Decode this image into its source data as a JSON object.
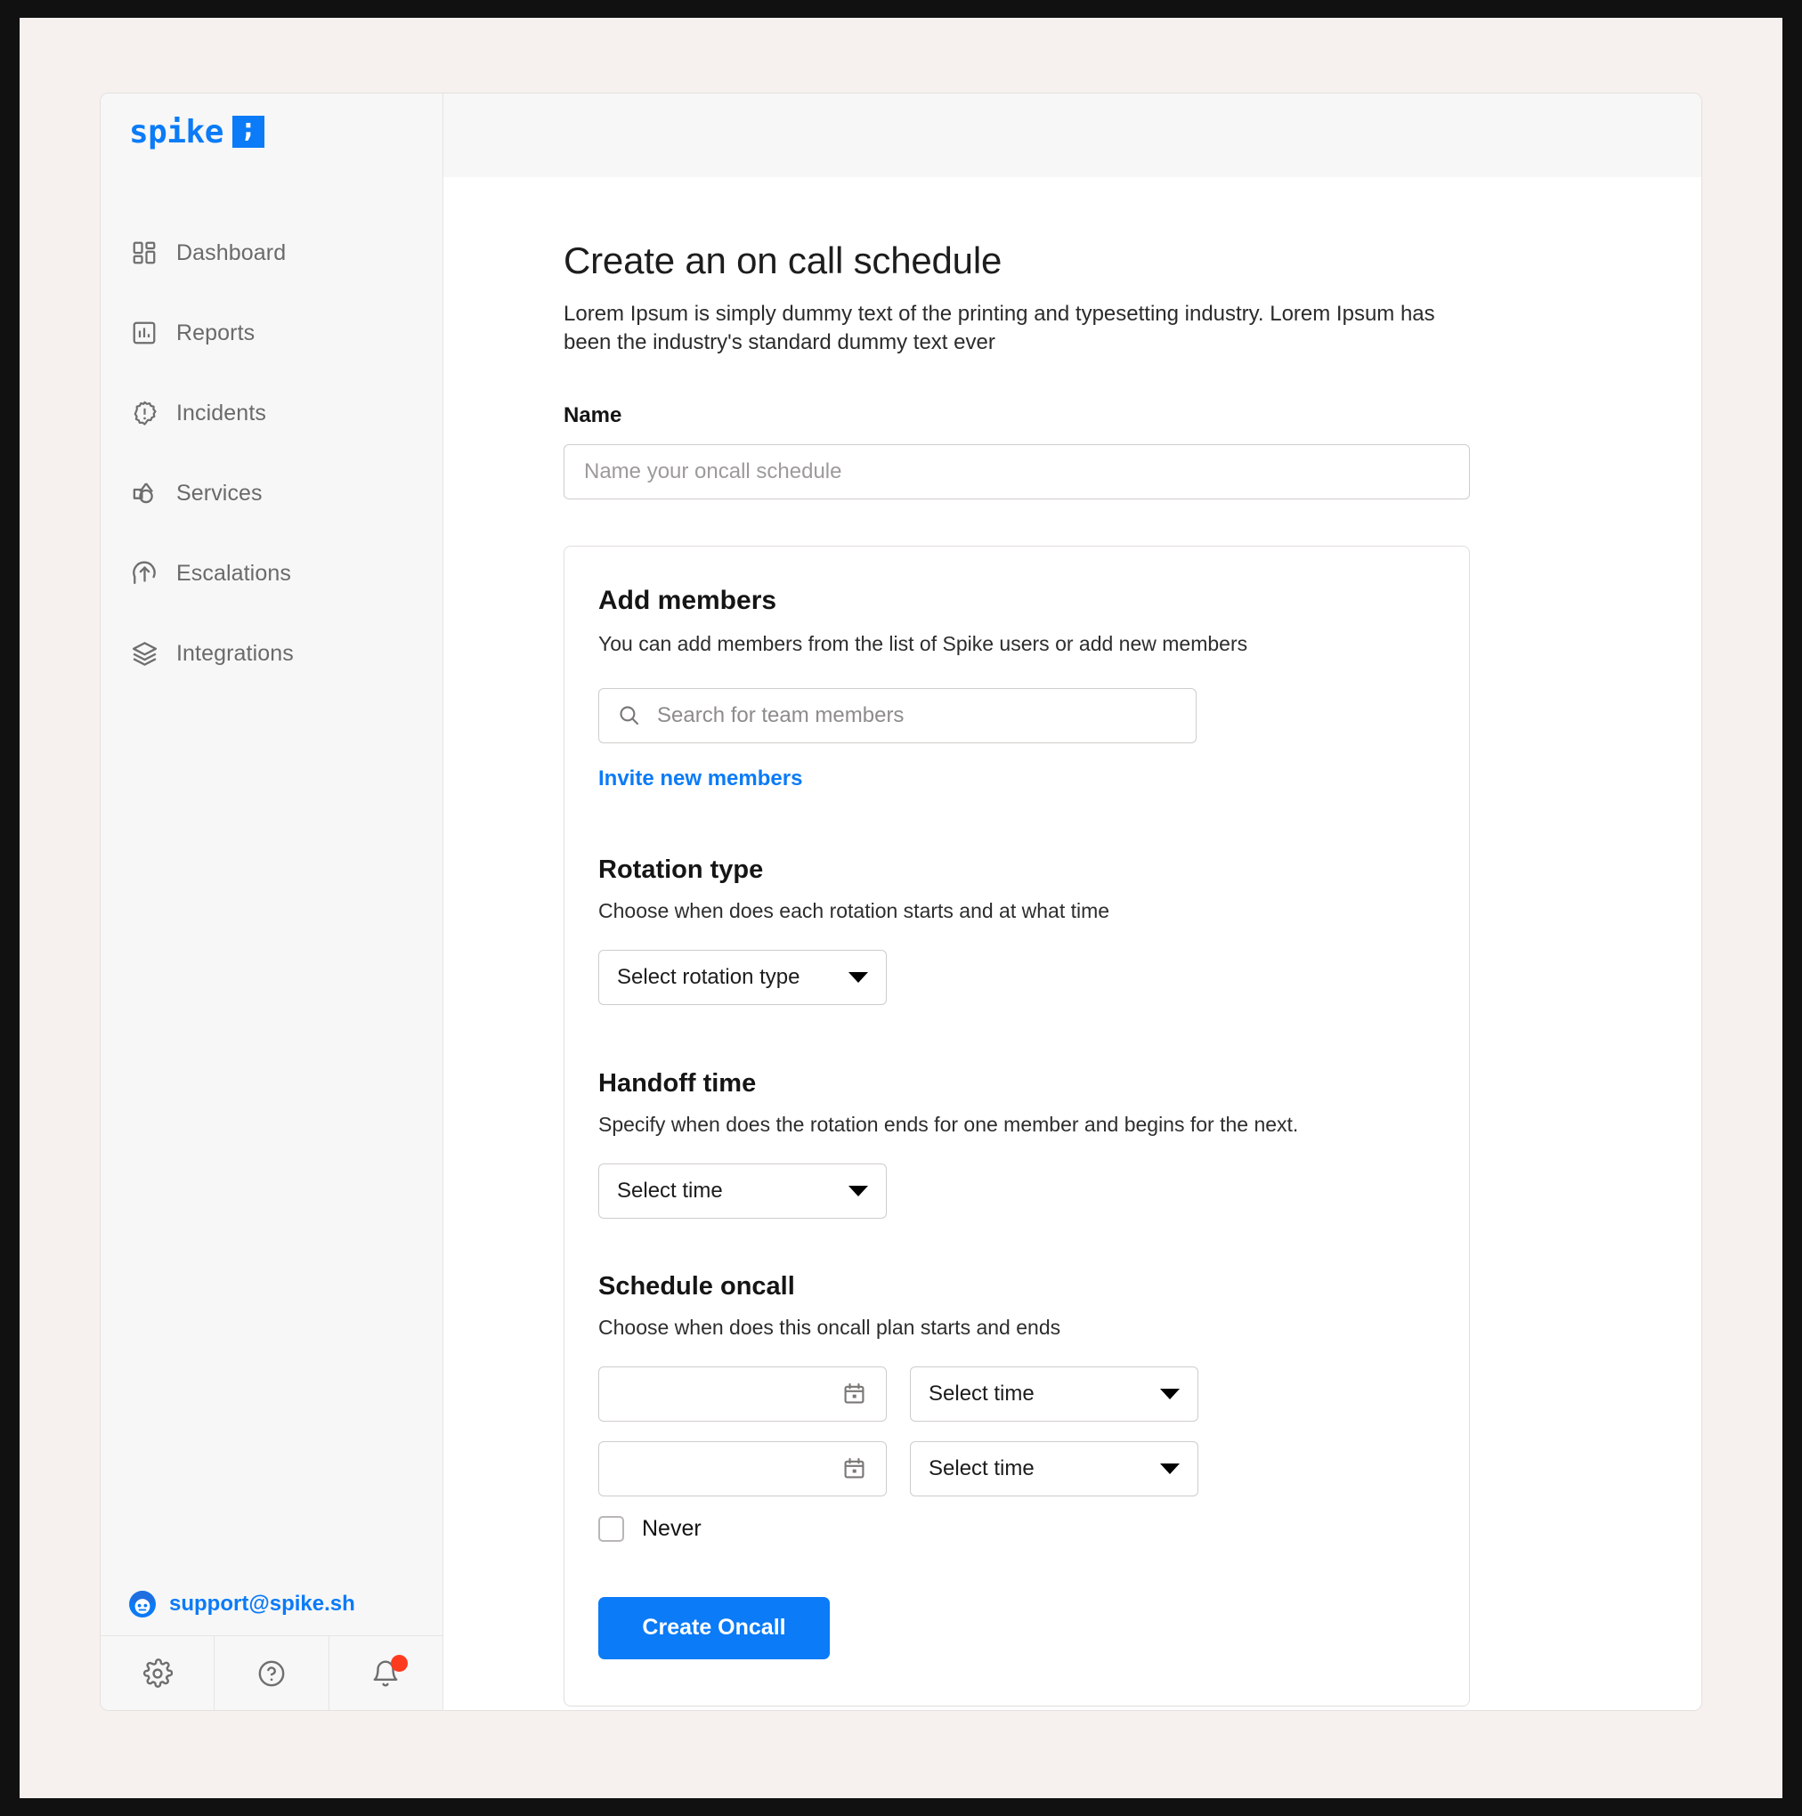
{
  "brand": {
    "word": "spike",
    "mark_glyph": ";",
    "accent_color": "#0b7bf7"
  },
  "sidebar": {
    "items": [
      {
        "label": "Dashboard",
        "icon": "dashboard-icon"
      },
      {
        "label": "Reports",
        "icon": "reports-icon"
      },
      {
        "label": "Incidents",
        "icon": "incidents-icon"
      },
      {
        "label": "Services",
        "icon": "services-icon"
      },
      {
        "label": "Escalations",
        "icon": "escalations-icon"
      },
      {
        "label": "Integrations",
        "icon": "integrations-icon"
      }
    ],
    "support_email": "support@spike.sh",
    "footer": {
      "settings_icon": "gear-icon",
      "help_icon": "question-circle-icon",
      "notifications_icon": "bell-icon",
      "notification_dot_color": "#ff3b1f"
    }
  },
  "main": {
    "title": "Create an on call schedule",
    "subtitle": "Lorem Ipsum is simply dummy text of the printing and typesetting industry. Lorem Ipsum has been the industry's standard dummy text ever",
    "name_field": {
      "label": "Name",
      "placeholder": "Name your oncall schedule",
      "value": ""
    },
    "members_card": {
      "title": "Add members",
      "subtitle": "You can add members from the list of Spike users or add new members",
      "search": {
        "placeholder": "Search for team members",
        "value": "",
        "icon": "search-icon"
      },
      "invite_link": "Invite new members",
      "rotation": {
        "title": "Rotation type",
        "subtitle": "Choose when does each rotation starts and at what time",
        "select_value": "Select rotation type"
      },
      "handoff": {
        "title": "Handoff time",
        "subtitle": "Specify when does the rotation ends for one member and begins for the next.",
        "select_value": "Select time"
      },
      "schedule": {
        "title": "Schedule oncall",
        "subtitle": "Choose when does this oncall plan starts and ends",
        "rows": [
          {
            "date_value": "",
            "date_icon": "calendar-icon",
            "time_value": "Select time"
          },
          {
            "date_value": "",
            "date_icon": "calendar-icon",
            "time_value": "Select time"
          }
        ],
        "never_label": "Never",
        "never_checked": false
      },
      "submit_label": "Create Oncall"
    }
  }
}
